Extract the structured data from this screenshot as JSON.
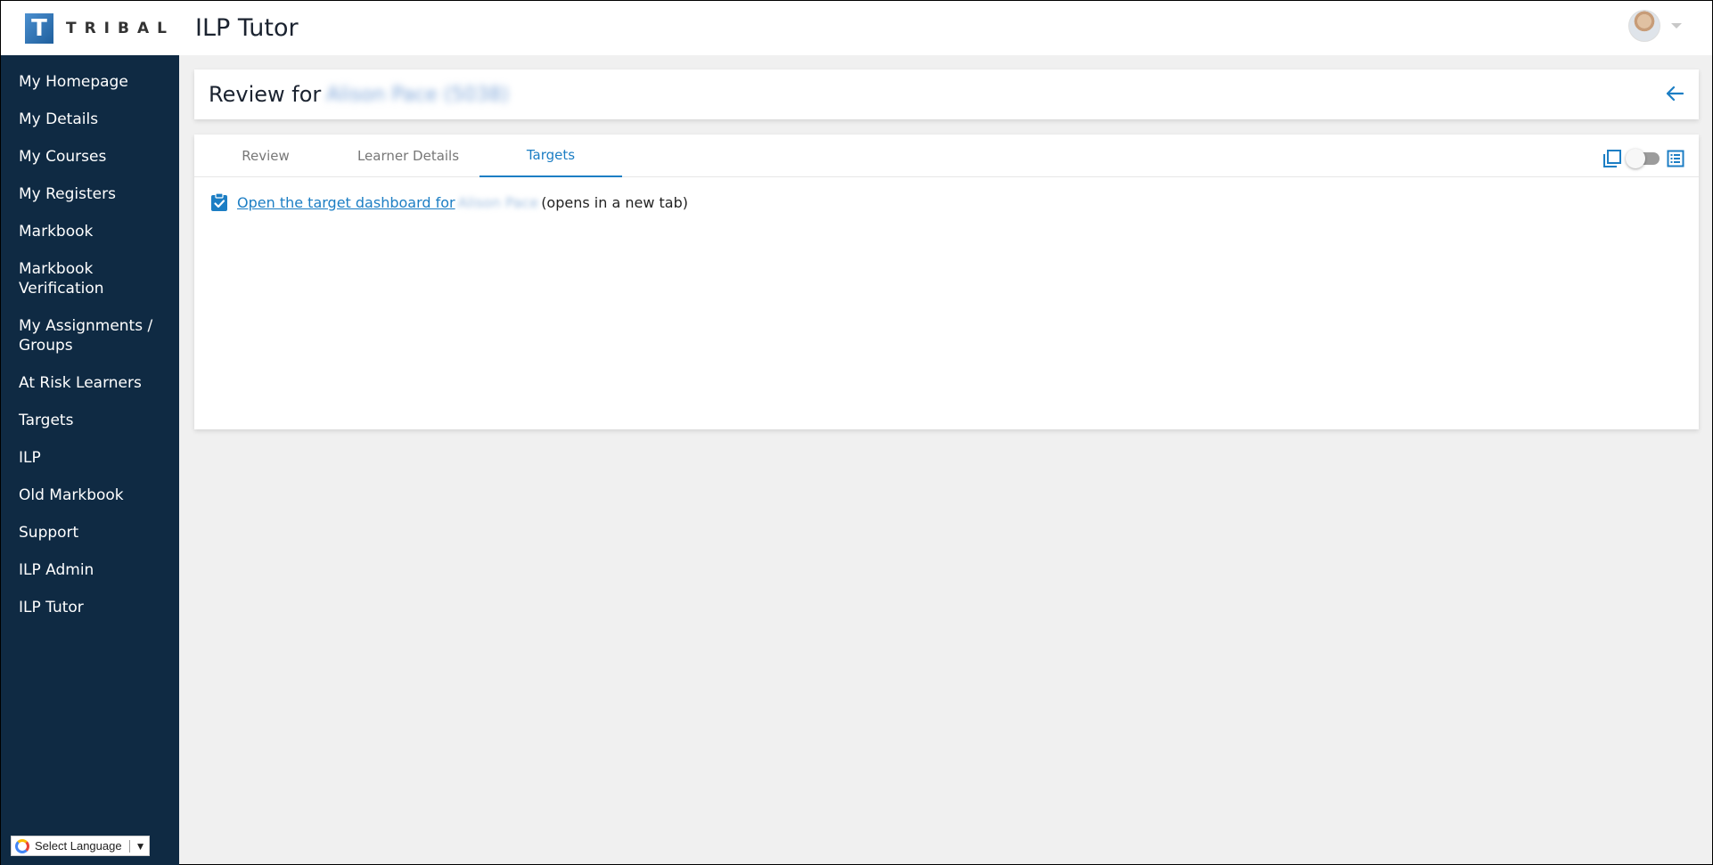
{
  "header": {
    "brand_letter": "T",
    "brand_word": "TRIBAL",
    "app_title": "ILP Tutor"
  },
  "sidebar": {
    "items": [
      {
        "label": "My Homepage"
      },
      {
        "label": "My Details"
      },
      {
        "label": "My Courses"
      },
      {
        "label": "My Registers"
      },
      {
        "label": "Markbook"
      },
      {
        "label": "Markbook Verification"
      },
      {
        "label": "My Assignments / Groups"
      },
      {
        "label": "At Risk Learners"
      },
      {
        "label": "Targets"
      },
      {
        "label": "ILP"
      },
      {
        "label": "Old Markbook"
      },
      {
        "label": "Support"
      },
      {
        "label": "ILP Admin"
      },
      {
        "label": "ILP Tutor"
      }
    ],
    "language_label": "Select Language"
  },
  "review": {
    "prefix": "Review for",
    "learner_name": "Alison Pace (5038)"
  },
  "tabs": [
    {
      "label": "Review"
    },
    {
      "label": "Learner Details"
    },
    {
      "label": "Targets"
    }
  ],
  "targets": {
    "link_text": "Open the target dashboard for",
    "learner_short": "Alison Pace",
    "suffix": "(opens in a new tab)"
  },
  "colors": {
    "sidebar_bg": "#0f2a43",
    "accent": "#1c7ec4"
  },
  "icons": {
    "back": "arrow-left-icon",
    "card_view": "card-view-icon",
    "list_view": "list-view-icon",
    "target": "clipboard-check-icon"
  }
}
